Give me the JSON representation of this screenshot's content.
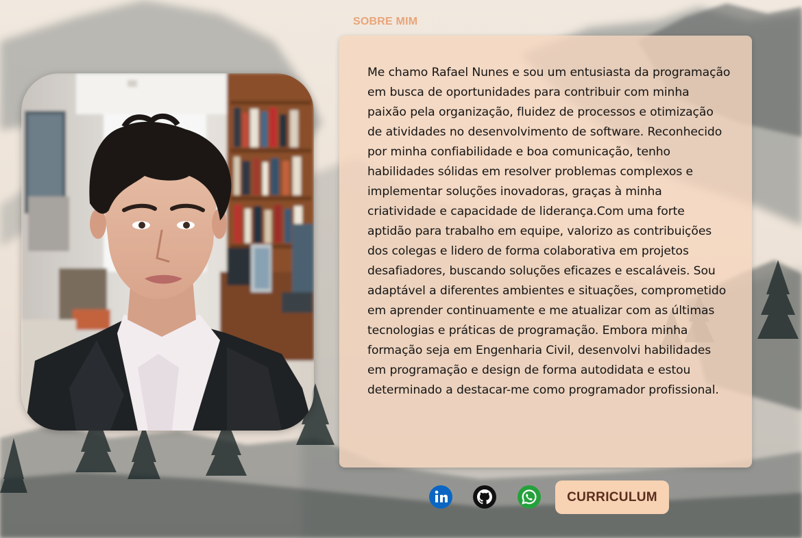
{
  "section": {
    "title": "SOBRE MIM"
  },
  "profile": {
    "photo_alt": "Foto de perfil",
    "bio": "Me chamo Rafael Nunes e sou um entusiasta da programação em busca de oportunidades para contribuir com minha paixão pela organização, fluidez de processos e otimização de atividades no desenvolvimento de software. Reconhecido por minha confiabilidade e boa comunicação, tenho habilidades sólidas em resolver problemas complexos e implementar soluções inovadoras, graças à minha criatividade e capacidade de liderança.Com uma forte aptidão para trabalho em equipe, valorizo as contribuições dos colegas e lidero de forma colaborativa em projetos desafiadores, buscando soluções eficazes e escaláveis. Sou adaptável a diferentes ambientes e situações, comprometido em aprender continuamente e me atualizar com as últimas tecnologias e práticas de programação. Embora minha formação seja em Engenharia Civil, desenvolvi habilidades em programação e design de forma autodidata e estou determinado a destacar-me como programador profissional."
  },
  "social": [
    {
      "icon": "linkedin-icon",
      "color": "#0a66c2"
    },
    {
      "icon": "github-icon",
      "color": "#111111"
    },
    {
      "icon": "whatsapp-icon",
      "color": "#25a13c"
    }
  ],
  "cv_button": {
    "label": "CURRICULUM"
  },
  "colors": {
    "accent": "#e8a47a",
    "card": "#f5d6be",
    "button": "#f7d2b3",
    "button_text": "#5a2e1e"
  }
}
